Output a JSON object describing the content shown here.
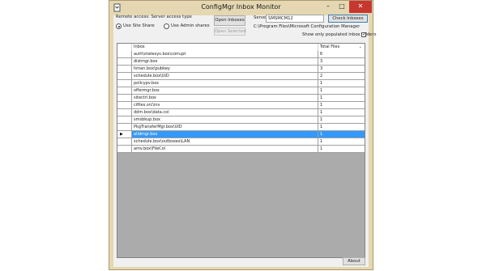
{
  "window": {
    "title": "ConfigMgr Inbox Monitor",
    "minimize_glyph": "–",
    "maximize_glyph": "□",
    "close_glyph": "✕"
  },
  "access": {
    "label": "Remote access: Server access type",
    "option_site_share": "Use Site Share",
    "option_admin_shares": "Use Admin shares",
    "selected": "Use Site Share"
  },
  "buttons": {
    "open_inboxes": "Open Inboxes",
    "open_selected": "Open Selected",
    "check_inboxes": "Check Inboxes",
    "about": "About"
  },
  "server": {
    "label": "Server",
    "value": "SMSMCM12",
    "path": "C:\\Program Files\\Microsoft Configuration Manager"
  },
  "filter": {
    "label": "Show only populated inbox folders",
    "checked": true,
    "check_glyph": "✓"
  },
  "grid": {
    "columns": [
      "Inbox",
      "Total Files"
    ],
    "sort_glyph": "⌄",
    "row_pointer": "▶",
    "rows": [
      {
        "inbox": "auth\\statesys.box\\corrupt",
        "files": "6"
      },
      {
        "inbox": "distmgr.box",
        "files": "3"
      },
      {
        "inbox": "hman.box\\pubkey",
        "files": "3"
      },
      {
        "inbox": "schedule.box\\UID",
        "files": "2"
      },
      {
        "inbox": "policypv.box",
        "files": "1"
      },
      {
        "inbox": "offermgr.box",
        "files": "1"
      },
      {
        "inbox": "sitectrl.box",
        "files": "1"
      },
      {
        "inbox": "cifiles.src\\inv",
        "files": "1"
      },
      {
        "inbox": "ddm.box\\data.col",
        "files": "1"
      },
      {
        "inbox": "smsbkup.box",
        "files": "1"
      },
      {
        "inbox": "PkgTransferMgr.box\\UID",
        "files": "1"
      },
      {
        "inbox": "alldmgr.box",
        "files": "1"
      },
      {
        "inbox": "schedule.box\\outboxes\\LAN",
        "files": "1"
      },
      {
        "inbox": "amv.box\\FileCol",
        "files": "1"
      }
    ],
    "selected_row": 11
  },
  "colors": {
    "frame": "#e4d7b1",
    "selection": "#3399ff",
    "grid_background": "#ababab"
  }
}
